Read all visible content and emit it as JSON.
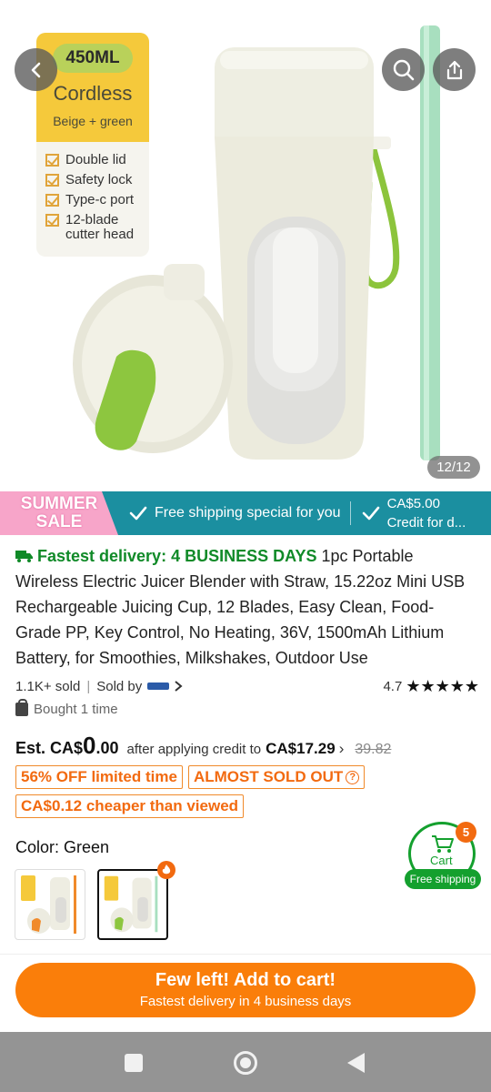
{
  "product_image": {
    "counter": "12/12",
    "label_card": {
      "capacity": "450ML",
      "title": "Cordless",
      "subtitle": "Beige + green",
      "features": [
        "Double lid",
        "Safety lock",
        "Type-c port",
        "12-blade cutter head"
      ]
    }
  },
  "promo_banner": {
    "sale_line1": "SUMMER",
    "sale_line2": "SALE",
    "free_shipping": "Free shipping special for you",
    "credit_amount": "CA$5.00",
    "credit_label": "Credit for d..."
  },
  "product": {
    "delivery": "Fastest delivery: 4 BUSINESS DAYS",
    "title": "1pc Portable Wireless Electric Juicer Blender with Straw, 15.22oz Mini USB Rechargeable Juicing Cup, 12 Blades, Easy Clean, Food-Grade PP, Key Control, No Heating, 36V, 1500mAh Lithium Battery, for Smoothies, Milkshakes, Outdoor Use",
    "sold": "1.1K+ sold",
    "sold_by": "Sold by",
    "rating": "4.7",
    "stars": "★★★★★",
    "bought": "Bought 1 time"
  },
  "pricing": {
    "est_prefix": "Est. CA$",
    "est_whole": "0",
    "est_decimal": ".00",
    "after_text": "after applying credit to",
    "credit_price": "CA$17.29",
    "original_price": "39.82",
    "badges": [
      "56% OFF limited time",
      "ALMOST SOLD OUT",
      "CA$0.12 cheaper than viewed"
    ]
  },
  "color": {
    "label": "Color: Green",
    "selected_index": 1
  },
  "cart": {
    "label": "Cart",
    "count": "5",
    "shipping": "Free shipping"
  },
  "cta": {
    "main": "Few left! Add to cart!",
    "sub": "Fastest delivery in 4 business days"
  },
  "colors": {
    "accent_orange": "#fa7e0a",
    "green": "#14a02e",
    "banner_teal": "#1b8fa0",
    "sale_pink": "#f7a5c9"
  }
}
